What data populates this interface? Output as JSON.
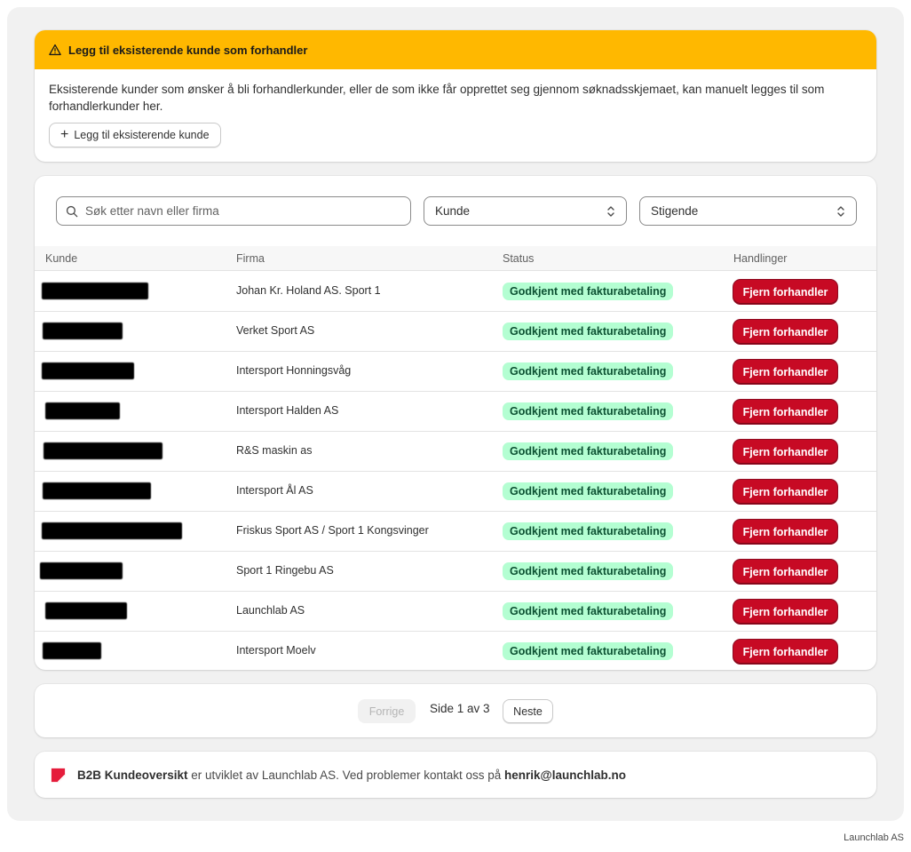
{
  "banner": {
    "title": "Legg til eksisterende kunde som forhandler",
    "description": "Eksisterende kunder som ønsker å bli forhandlerkunder, eller de som ikke får opprettet seg gjennom søknadsskjemaet, kan manuelt legges til som forhandlerkunder her.",
    "add_button": "Legg til eksisterende kunde"
  },
  "filters": {
    "search_placeholder": "Søk etter navn eller firma",
    "sort_field": "Kunde",
    "sort_order": "Stigende"
  },
  "table": {
    "headers": [
      "Kunde",
      "Firma",
      "Status",
      "Handlinger"
    ],
    "rows": [
      {
        "firma": "Johan Kr. Holand AS. Sport 1",
        "status": "Godkjent med fakturabetaling",
        "action": "Fjern forhandler"
      },
      {
        "firma": "Verket Sport AS",
        "status": "Godkjent med fakturabetaling",
        "action": "Fjern forhandler"
      },
      {
        "firma": "Intersport Honningsvåg",
        "status": "Godkjent med fakturabetaling",
        "action": "Fjern forhandler"
      },
      {
        "firma": "Intersport Halden AS",
        "status": "Godkjent med fakturabetaling",
        "action": "Fjern forhandler"
      },
      {
        "firma": "R&S maskin as",
        "status": "Godkjent med fakturabetaling",
        "action": "Fjern forhandler"
      },
      {
        "firma": "Intersport Ål AS",
        "status": "Godkjent med fakturabetaling",
        "action": "Fjern forhandler"
      },
      {
        "firma": "Friskus Sport AS / Sport 1 Kongsvinger",
        "status": "Godkjent med fakturabetaling",
        "action": "Fjern forhandler"
      },
      {
        "firma": "Sport 1 Ringebu AS",
        "status": "Godkjent med fakturabetaling",
        "action": "Fjern forhandler"
      },
      {
        "firma": "Launchlab AS",
        "status": "Godkjent med fakturabetaling",
        "action": "Fjern forhandler"
      },
      {
        "firma": "Intersport Moelv",
        "status": "Godkjent med fakturabetaling",
        "action": "Fjern forhandler"
      }
    ]
  },
  "pagination": {
    "prev": "Forrige",
    "label": "Side 1 av 3",
    "next": "Neste"
  },
  "footer": {
    "app_name": "B2B Kundeoversikt",
    "text": " er utviklet av Launchlab AS. Ved problemer kontakt oss på ",
    "email": "henrik@launchlab.no"
  },
  "watermark": "Launchlab AS",
  "colors": {
    "banner": "#ffb800",
    "badge_bg": "#b4fed2",
    "danger": "#c70a24",
    "logo": "#e51c3b"
  }
}
